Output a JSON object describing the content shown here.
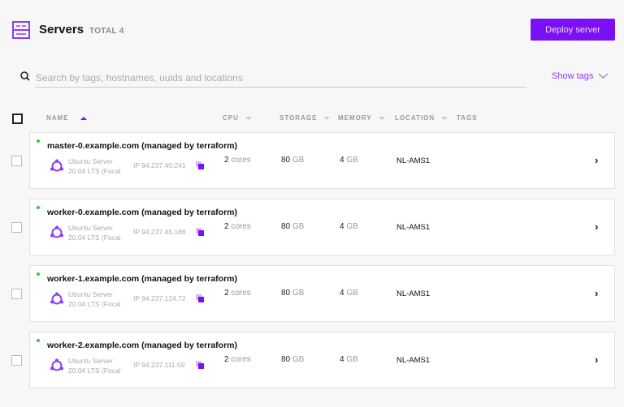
{
  "header": {
    "title": "Servers",
    "total": "TOTAL 4",
    "deploy_label": "Deploy server"
  },
  "search": {
    "placeholder": "Search by tags, hostnames, uuids and locations",
    "value": "",
    "show_tags": "Show tags"
  },
  "columns": [
    "NAME",
    "CPU",
    "STORAGE",
    "MEMORY",
    "LOCATION",
    "TAGS"
  ],
  "accent": "#7b0ff5",
  "servers": [
    {
      "name": "master-0.example.com (managed by terraform)",
      "os1": "Ubuntu Server",
      "os2": "20.04 LTS (Focal",
      "ip": "IP 94.237.40.241",
      "cpu": "2",
      "cpu_unit": "cores",
      "storage": "80",
      "storage_unit": "GB",
      "memory": "4",
      "memory_unit": "GB",
      "location": "NL-AMS1"
    },
    {
      "name": "worker-0.example.com (managed by terraform)",
      "os1": "Ubuntu Server",
      "os2": "20.04 LTS (Focal",
      "ip": "IP 94.237.45.186",
      "cpu": "2",
      "cpu_unit": "cores",
      "storage": "80",
      "storage_unit": "GB",
      "memory": "4",
      "memory_unit": "GB",
      "location": "NL-AMS1"
    },
    {
      "name": "worker-1.example.com (managed by terraform)",
      "os1": "Ubuntu Server",
      "os2": "20.04 LTS (Focal",
      "ip": "IP 94.237.124.72",
      "cpu": "2",
      "cpu_unit": "cores",
      "storage": "80",
      "storage_unit": "GB",
      "memory": "4",
      "memory_unit": "GB",
      "location": "NL-AMS1"
    },
    {
      "name": "worker-2.example.com (managed by terraform)",
      "os1": "Ubuntu Server",
      "os2": "20.04 LTS (Focal",
      "ip": "IP 94.237.111.59",
      "cpu": "2",
      "cpu_unit": "cores",
      "storage": "80",
      "storage_unit": "GB",
      "memory": "4",
      "memory_unit": "GB",
      "location": "NL-AMS1"
    }
  ]
}
